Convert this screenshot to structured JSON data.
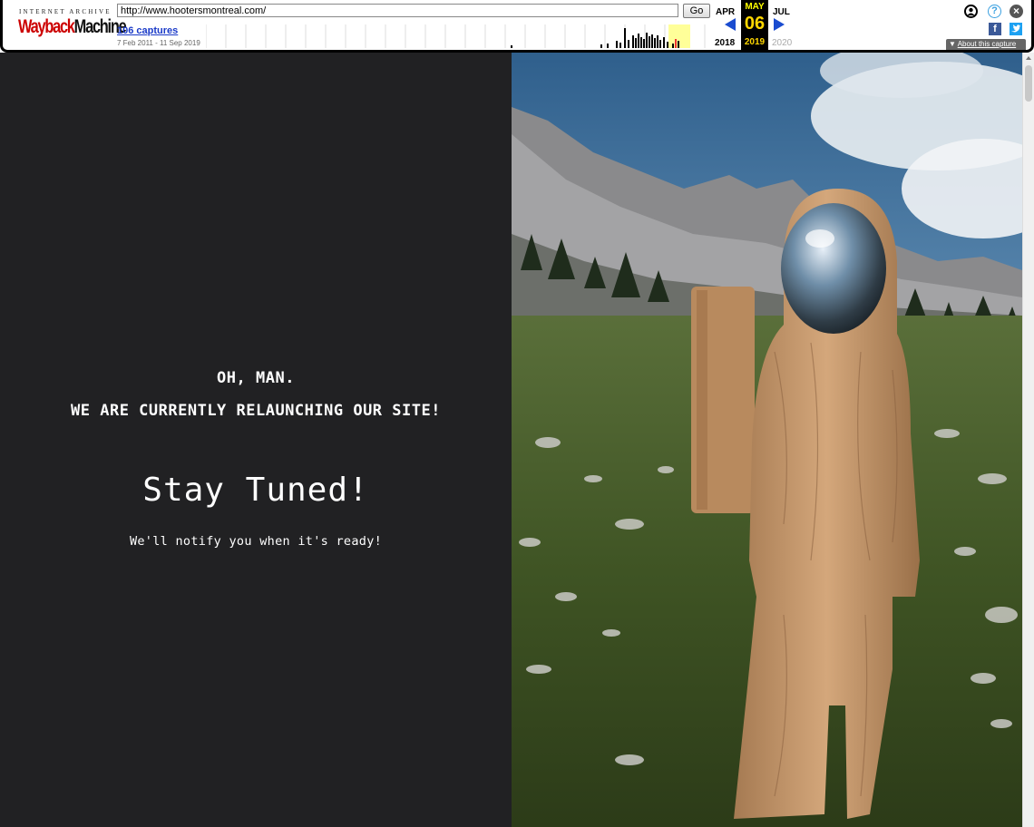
{
  "wayback": {
    "logo_top": "INTERNET ARCHIVE",
    "logo_main_a": "Wayback",
    "logo_main_b": "Machine",
    "url": "http://www.hootersmontreal.com/",
    "go_label": "Go",
    "captures_label": "106 captures",
    "date_range": "7 Feb 2011 - 11 Sep 2019",
    "prev_month": "APR",
    "current_month": "MAY",
    "next_month": "JUL",
    "current_day": "06",
    "prev_year": "2018",
    "current_year": "2019",
    "next_year": "2020",
    "about_label": "About this capture",
    "icons": {
      "user": "user-icon",
      "help": "help-icon",
      "close": "close-icon",
      "facebook": "facebook-icon",
      "twitter": "twitter-icon"
    },
    "colors": {
      "accent": "#1a4cd0",
      "current": "#ffd700",
      "highlight": "#ffff99"
    }
  },
  "page": {
    "line1": "OH, MAN.",
    "line2": "WE ARE CURRENTLY RELAUNCHING OUR SITE!",
    "headline": "Stay Tuned!",
    "subtext": "We'll notify you when it's ready!",
    "colors": {
      "left_bg": "#212123",
      "text": "#ffffff"
    }
  }
}
